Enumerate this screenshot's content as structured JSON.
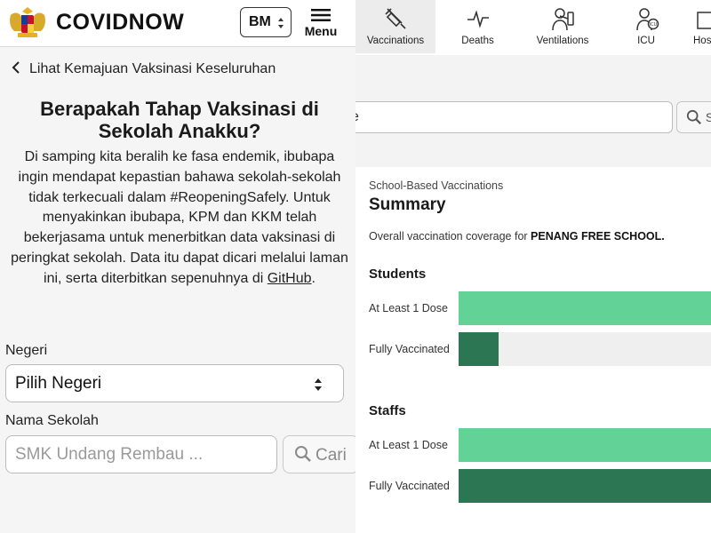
{
  "colors": {
    "dose1_green": "#63d296",
    "fully_green": "#2d7653",
    "track_gray": "#efefef",
    "panel_bg": "#f5f5f5"
  },
  "left": {
    "header": {
      "brand": "COVIDNOW",
      "logo_icon": "malaysia-coat-of-arms",
      "language": "BM",
      "menu_label": "Menu"
    },
    "back_link": "Lihat Kemajuan Vaksinasi Keseluruhan",
    "title": "Berapakah Tahap Vaksinasi di Sekolah Anakku?",
    "intro": {
      "text": "Di samping kita beralih ke fasa endemik, ibubapa ingin mendapat kepastian bahawa sekolah-sekolah tidak terkecuali dalam #ReopeningSafely. Untuk menyakinkan ibubapa, KPM dan KKM telah bekerjasama untuk menerbitkan data vaksinasi di peringkat sekolah. Data itu dapat dicari melalui laman ini, serta diterbitkan sepenuhnya di",
      "link": "GitHub",
      "end": "."
    },
    "form": {
      "state_label": "Negeri",
      "state_value": "Pilih Negeri",
      "school_label": "Nama Sekolah",
      "school_placeholder": "SMK Undang Rembau ...",
      "search_button": "Cari"
    }
  },
  "right": {
    "tabs": [
      {
        "label": "Vaccinations",
        "icon": "syringe-icon",
        "active": true
      },
      {
        "label": "Deaths",
        "icon": "heartbeat-icon",
        "active": false
      },
      {
        "label": "Ventilations",
        "icon": "ventilator-icon",
        "active": false
      },
      {
        "label": "ICU",
        "icon": "icu-icon",
        "active": false
      },
      {
        "label": "Hos",
        "icon": "hospital-icon",
        "active": false
      }
    ],
    "search": {
      "input_fragment": "e",
      "button_fragment": "S"
    },
    "summary": {
      "kicker": "School-Based Vaccinations",
      "title": "Summary",
      "desc_prefix": "Overall vaccination coverage for",
      "school_name": "PENANG FREE SCHOOL.",
      "groups": [
        {
          "name": "Students",
          "bars": [
            {
              "label": "At Least 1 Dose",
              "fraction": 1.0,
              "color": "dose1_green"
            },
            {
              "label": "Fully Vaccinated",
              "fraction": 0.16,
              "color": "fully_green"
            }
          ]
        },
        {
          "name": "Staffs",
          "bars": [
            {
              "label": "At Least 1 Dose",
              "fraction": 1.0,
              "color": "dose1_green"
            },
            {
              "label": "Fully Vaccinated",
              "fraction": 1.0,
              "color": "fully_green"
            }
          ]
        }
      ]
    }
  }
}
